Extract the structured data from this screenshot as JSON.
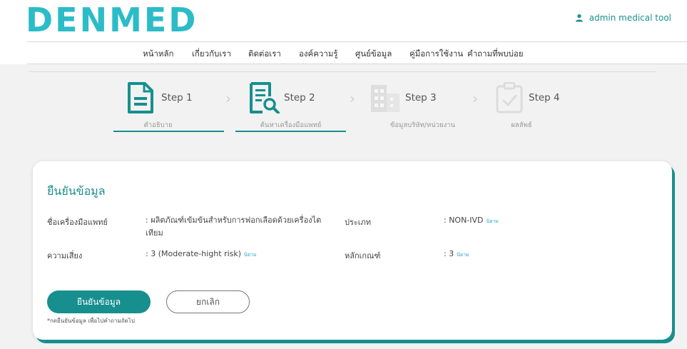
{
  "header": {
    "logo": "DENMED",
    "user_label": "admin medical tool"
  },
  "nav": {
    "items": [
      {
        "label": "หน้าหลัก"
      },
      {
        "label": "เกี่ยวกับเรา"
      },
      {
        "label": "ติดต่อเรา"
      },
      {
        "label": "องค์ความรู้"
      },
      {
        "label": "ศูนย์ข้อมูล"
      },
      {
        "label": "คู่มือการใช้งาน"
      },
      {
        "label": "คำถามที่พบบ่อย"
      }
    ]
  },
  "steps": [
    {
      "label": "Step 1",
      "sub": "คำอธิบาย",
      "state": "done",
      "icon": "document-icon"
    },
    {
      "label": "Step 2",
      "sub": "ค้นหาเครื่องมือแพทย์",
      "state": "active",
      "icon": "document-search-icon"
    },
    {
      "label": "Step 3",
      "sub": "ข้อมูลบริษัท/หน่วยงาน",
      "state": "inactive",
      "icon": "building-icon"
    },
    {
      "label": "Step 4",
      "sub": "ผลลัพธ์",
      "state": "inactive",
      "icon": "clipboard-check-icon"
    }
  ],
  "card": {
    "title": "ยืนยันข้อมูล",
    "device_name_label": "ชื่อเครื่องมือแพทย์",
    "device_name_value": ": ผลิตภัณฑ์เข้มข้นสำหรับการฟอกเลือดด้วยเครื่องไตเทียม",
    "type_label": "ประเภท",
    "type_value": ": NON-IVD",
    "risk_label": "ความเสี่ยง",
    "risk_value": ": 3 (Moderate-hight risk)",
    "criteria_label": "หลักเกณฑ์",
    "criteria_value": ": 3",
    "define_tag": "นิยาม",
    "confirm_button": "ยืนยันข้อมูล",
    "cancel_button": "ยกเลิก",
    "note": "*กดยืนยันข้อมูล เพื่อไปคำถามถัดไป"
  },
  "colors": {
    "accent": "#178f8f",
    "logo": "#2bbcc8",
    "background": "#f2f2f2"
  }
}
